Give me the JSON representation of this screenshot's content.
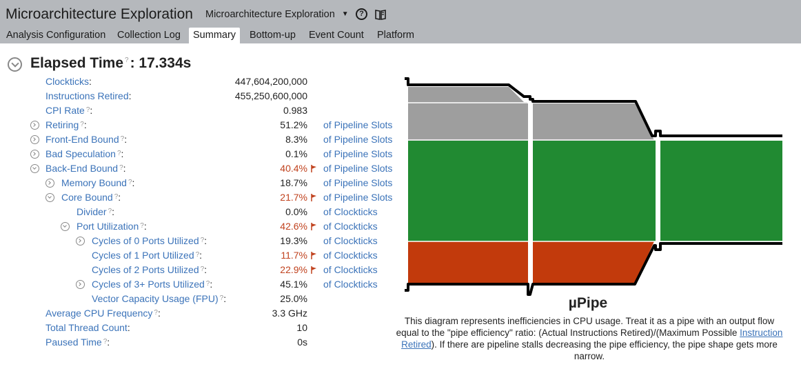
{
  "header": {
    "title": "Microarchitecture Exploration",
    "view_selector": "Microarchitecture Exploration",
    "tabs": [
      "Analysis Configuration",
      "Collection Log",
      "Summary",
      "Bottom-up",
      "Event Count",
      "Platform"
    ],
    "active_tab": "Summary"
  },
  "summary": {
    "elapsed_label": "Elapsed Time",
    "elapsed_value": ": 17.334s",
    "metrics": [
      {
        "label": "Clockticks",
        "help": false,
        "value": "447,604,200,000",
        "unit": "",
        "flag": false
      },
      {
        "label": "Instructions Retired",
        "help": false,
        "value": "455,250,600,000",
        "unit": "",
        "flag": false
      },
      {
        "label": "CPI Rate",
        "help": true,
        "value": "0.983",
        "unit": "",
        "flag": false
      },
      {
        "label": "Retiring",
        "help": true,
        "value": "51.2%",
        "unit": "of Pipeline Slots",
        "flag": false,
        "toggle": "closed"
      },
      {
        "label": "Front-End Bound",
        "help": true,
        "value": "8.3%",
        "unit": "of Pipeline Slots",
        "flag": false,
        "toggle": "closed"
      },
      {
        "label": "Bad Speculation",
        "help": true,
        "value": "0.1%",
        "unit": "of Pipeline Slots",
        "flag": false,
        "toggle": "closed"
      },
      {
        "label": "Back-End Bound",
        "help": true,
        "value": "40.4%",
        "unit": "of Pipeline Slots",
        "flag": true,
        "toggle": "open"
      },
      {
        "label": "Memory Bound",
        "help": true,
        "value": "18.7%",
        "unit": "of Pipeline Slots",
        "flag": false,
        "toggle": "closed"
      },
      {
        "label": "Core Bound",
        "help": true,
        "value": "21.7%",
        "unit": "of Pipeline Slots",
        "flag": true,
        "toggle": "open"
      },
      {
        "label": "Divider",
        "help": true,
        "value": "0.0%",
        "unit": "of Clockticks",
        "flag": false
      },
      {
        "label": "Port Utilization",
        "help": true,
        "value": "42.6%",
        "unit": "of Clockticks",
        "flag": true,
        "toggle": "open"
      },
      {
        "label": "Cycles of 0 Ports Utilized",
        "help": true,
        "value": "19.3%",
        "unit": "of Clockticks",
        "flag": false,
        "toggle": "closed"
      },
      {
        "label": "Cycles of 1 Port Utilized",
        "help": true,
        "value": "11.7%",
        "unit": "of Clockticks",
        "flag": true
      },
      {
        "label": "Cycles of 2 Ports Utilized",
        "help": true,
        "value": "22.9%",
        "unit": "of Clockticks",
        "flag": true
      },
      {
        "label": "Cycles of 3+ Ports Utilized",
        "help": true,
        "value": "45.1%",
        "unit": "of Clockticks",
        "flag": false,
        "toggle": "closed"
      },
      {
        "label": "Vector Capacity Usage (FPU)",
        "help": true,
        "value": "25.0%",
        "unit": "",
        "flag": false
      },
      {
        "label": "Average CPU Frequency",
        "help": true,
        "value": "3.3 GHz",
        "unit": "",
        "flag": false
      },
      {
        "label": "Total Thread Count",
        "help": false,
        "value": "10",
        "unit": "",
        "flag": false
      },
      {
        "label": "Paused Time",
        "help": true,
        "value": "0s",
        "unit": "",
        "flag": false
      }
    ]
  },
  "upipe": {
    "title": "µPipe",
    "desc_1": "This diagram represents inefficiencies in CPU usage. Treat it as a pipe with an output flow equal to the \"pipe efficiency\" ratio: (Actual Instructions Retired)/(Maximum Possible ",
    "desc_link": "Instruction Retired",
    "desc_2": "). If there are pipeline stalls decreasing the pipe efficiency, the pipe shape gets more narrow.",
    "colors": {
      "front_end": "#9e9e9e",
      "retiring": "#218a32",
      "back_end": "#c23a0c",
      "outline": "#000000"
    }
  }
}
